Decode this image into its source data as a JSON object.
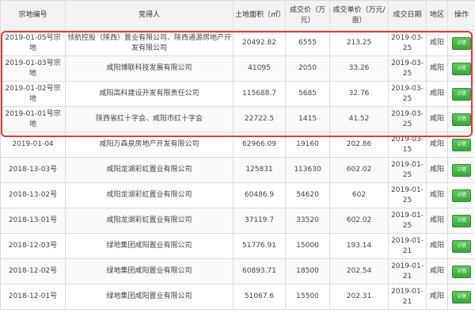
{
  "headers": {
    "code": "宗地编号",
    "buyer": "竞得人",
    "area": "土地面积（㎡）",
    "price": "成交价（万元）",
    "unit_price": "成交单价（万元/亩）",
    "date": "成交日期",
    "region": "地区",
    "action": "操作"
  },
  "action_label": "详情",
  "highlight_color": "#e23b3b",
  "rows": [
    {
      "code": "2019-01-05号宗地",
      "buyer": "领航控股（陕西）置业有限公司、陕西通源房地产开发有限公司",
      "area": "20492.82",
      "price": "6555",
      "unit_price": "213.25",
      "date": "2019-03-25",
      "region": "咸阳"
    },
    {
      "code": "2019-01-03号宗地",
      "buyer": "咸阳博联科技发展有限公司",
      "area": "41095",
      "price": "2050",
      "unit_price": "33.26",
      "date": "2019-03-25",
      "region": "咸阳"
    },
    {
      "code": "2019-01-02号宗地",
      "buyer": "咸阳高科建设开发有限责任公司",
      "area": "115688.7",
      "price": "5685",
      "unit_price": "32.76",
      "date": "2019-03-25",
      "region": "咸阳"
    },
    {
      "code": "2019-01-01号宗地",
      "buyer": "陕西省红十字会、咸阳市红十字会",
      "area": "22722.5",
      "price": "1415",
      "unit_price": "41.52",
      "date": "2019-03-25",
      "region": "咸阳"
    },
    {
      "code": "2019-01-04",
      "buyer": "咸阳万森泉房地产开发有限公司",
      "area": "62966.09",
      "price": "19160",
      "unit_price": "202.86",
      "date": "2019-03-15",
      "region": "咸阳"
    },
    {
      "code": "2018-13-03号",
      "buyer": "咸阳龙湖彩虹置业有限公司",
      "area": "125831",
      "price": "113630",
      "unit_price": "602.02",
      "date": "2019-01-25",
      "region": "咸阳"
    },
    {
      "code": "2018-13-02号",
      "buyer": "咸阳龙湖彩虹置业有限公司",
      "area": "60486.9",
      "price": "54620",
      "unit_price": "602",
      "date": "2019-01-25",
      "region": "咸阳"
    },
    {
      "code": "2018-13-01号",
      "buyer": "咸阳龙湖彩虹置业有限公司",
      "area": "37119.7",
      "price": "33520",
      "unit_price": "602.02",
      "date": "2019-01-25",
      "region": "咸阳"
    },
    {
      "code": "2018-12-03号",
      "buyer": "绿地集团咸阳置业有限公司",
      "area": "51776.91",
      "price": "15000",
      "unit_price": "193.14",
      "date": "2019-01-21",
      "region": "咸阳"
    },
    {
      "code": "2018-12-02号",
      "buyer": "绿地集团咸阳置业有限公司",
      "area": "60893.71",
      "price": "18500",
      "unit_price": "202.54",
      "date": "2019-01-21",
      "region": "咸阳"
    },
    {
      "code": "2018-12-01号",
      "buyer": "绿地集团咸阳置业有限公司",
      "area": "51067.6",
      "price": "15500",
      "unit_price": "202.31",
      "date": "2019-01-21",
      "region": "咸阳"
    }
  ]
}
